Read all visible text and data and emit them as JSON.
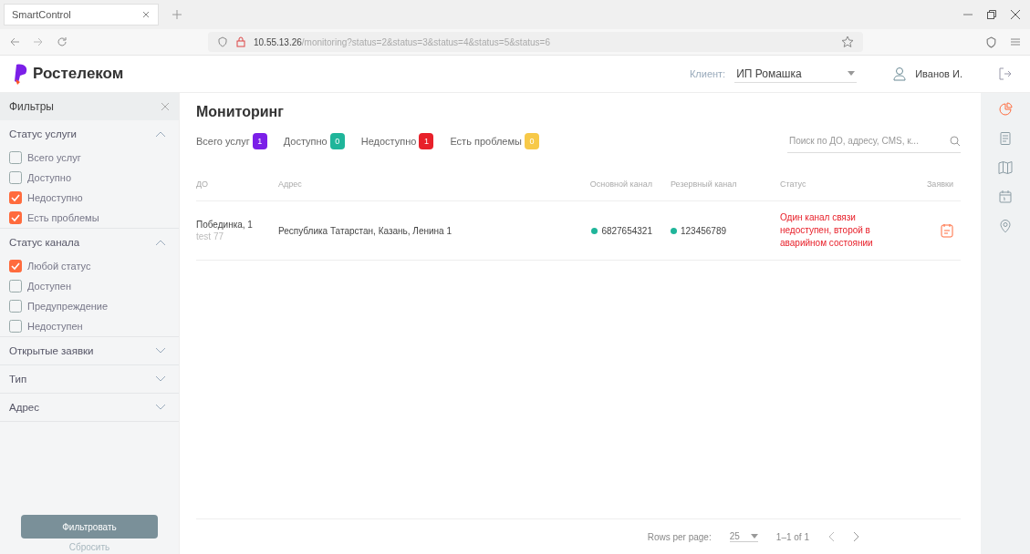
{
  "browser": {
    "tab_title": "SmartControl",
    "url_host": "10.55.13.26",
    "url_path": "/monitoring?status=2&status=3&status=4&status=5&status=6"
  },
  "header": {
    "logo": "Ростелеком",
    "client_label": "Клиент:",
    "client_value": "ИП Ромашка",
    "user": "Иванов И."
  },
  "filters": {
    "title": "Фильтры",
    "groups": [
      {
        "title": "Статус услуги",
        "expanded": true,
        "items": [
          {
            "label": "Всего услуг",
            "checked": false
          },
          {
            "label": "Доступно",
            "checked": false
          },
          {
            "label": "Недоступно",
            "checked": true
          },
          {
            "label": "Есть проблемы",
            "checked": true
          }
        ]
      },
      {
        "title": "Статус канала",
        "expanded": true,
        "items": [
          {
            "label": "Любой статус",
            "checked": true
          },
          {
            "label": "Доступен",
            "checked": false
          },
          {
            "label": "Предупреждение",
            "checked": false
          },
          {
            "label": "Недоступен",
            "checked": false
          }
        ]
      },
      {
        "title": "Открытые заявки",
        "expanded": false
      },
      {
        "title": "Тип",
        "expanded": false
      },
      {
        "title": "Адрес",
        "expanded": false
      }
    ],
    "apply": "Фильтровать",
    "reset": "Сбросить"
  },
  "page_title": "Мониторинг",
  "counters": [
    {
      "label": "Всего услуг",
      "count": "1",
      "color": "#7b1fe8"
    },
    {
      "label": "Доступно",
      "count": "0",
      "color": "#1fb59a"
    },
    {
      "label": "Недоступно",
      "count": "1",
      "color": "#e8202a"
    },
    {
      "label": "Есть проблемы",
      "count": "0",
      "color": "#f7c948"
    }
  ],
  "search": {
    "placeholder": "Поиск по ДО, адресу, CMS, к..."
  },
  "table": {
    "columns": [
      "ДО",
      "Адрес",
      "Основной канал",
      "Резервный канал",
      "Статус",
      "Заявки"
    ],
    "rows": [
      {
        "name": "Побединка, 1",
        "sub": "test 77",
        "address": "Республика Татарстан, Казань, Ленина 1",
        "channels": [
          {
            "number": "6827654321",
            "color": "#1fb59a"
          },
          {
            "number": "123456789",
            "color": "#1fb59a"
          }
        ],
        "status": "Один канал связи недоступен, второй в аварийном состоянии"
      }
    ]
  },
  "footer": {
    "rows_label": "Rows per page:",
    "rows_value": "25",
    "range": "1–1 of 1"
  },
  "rail": [
    {
      "selected": true
    },
    {
      "selected": false
    },
    {
      "selected": false
    },
    {
      "selected": false
    },
    {
      "selected": false
    }
  ]
}
